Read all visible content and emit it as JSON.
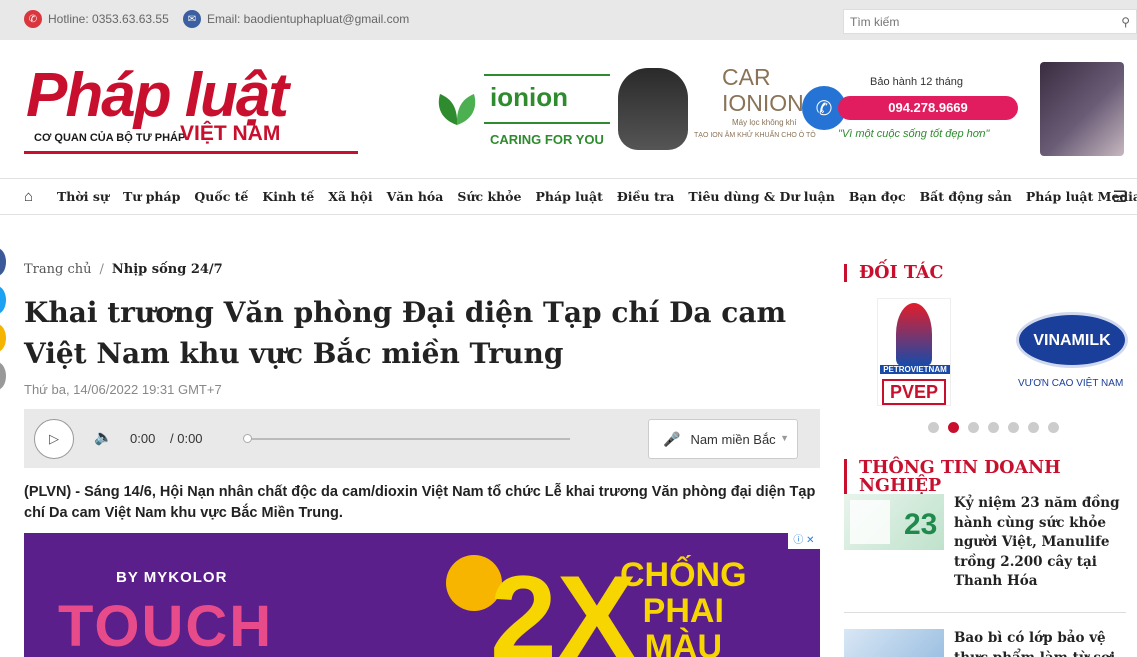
{
  "topbar": {
    "hotline": "Hotline: 0353.63.63.55",
    "email": "Email: baodientuphapluat@gmail.com",
    "search_placeholder": "Tìm kiếm"
  },
  "logo": {
    "word": "Pháp luật",
    "tagline": "CƠ QUAN CỦA BỘ TƯ PHÁP",
    "country": "VIỆT NAM"
  },
  "banner": {
    "brand": "ionion",
    "slogan": "CARING FOR YOU",
    "product_line1": "CAR",
    "product_line2": "IONION",
    "product_sub": "Máy lọc không khí",
    "product_sub2": "TẠO ION ÂM KHỬ KHUẨN CHO Ô TÔ",
    "warranty": "Bảo hành 12 tháng",
    "phone": "094.278.9669",
    "quote": "\"Vì một cuộc sống tốt đẹp hơn\""
  },
  "nav": {
    "items": [
      "Thời sự",
      "Tư pháp",
      "Quốc tế",
      "Kinh tế",
      "Xã hội",
      "Văn hóa",
      "Sức khỏe",
      "Pháp luật",
      "Điều tra",
      "Tiêu dùng & Dư luận",
      "Bạn đọc",
      "Bất động sản",
      "Pháp luật Media"
    ]
  },
  "breadcrumb": {
    "home": "Trang chủ",
    "separator": "/",
    "current": "Nhịp sống 24/7"
  },
  "article": {
    "title": "Khai trương Văn phòng Đại diện Tạp chí Da cam Việt Nam khu vực Bắc miền Trung",
    "date": "Thứ ba, 14/06/2022 19:31 GMT+7",
    "lead": "(PLVN) - Sáng 14/6, Hội Nạn nhân chất độc da cam/dioxin Việt Nam tổ chức Lễ khai trương Văn phòng đại diện Tạp chí Da cam Việt Nam khu vực Bắc Miền Trung."
  },
  "audio": {
    "current_time": "0:00",
    "duration": "/ 0:00",
    "voice": "Nam miền Bắc"
  },
  "ad": {
    "by": "BY MYKOLOR",
    "product": "TOUCH",
    "big": "2X",
    "line1": "CHỐNG",
    "line2": "PHAI",
    "line3": "MÀU"
  },
  "sidebar": {
    "partners_heading": "ĐỐI TÁC",
    "pvep_top": "PETROVIETNAM",
    "pvep_name": "PVEP",
    "vinamilk_name": "VINAMILK",
    "vinamilk_slogan": "VƯƠN CAO VIỆT NAM",
    "carousel_count": 7,
    "carousel_active": 2,
    "business_heading": "THÔNG TIN DOANH NGHIỆP",
    "news": [
      {
        "title": "Kỷ niệm 23 năm đồng hành cùng sức khỏe người Việt, Manulife trồng 2.200 cây tại Thanh Hóa"
      },
      {
        "title": "Bao bì có lớp bảo vệ thực phẩm làm từ sợi gỗ"
      }
    ]
  },
  "colors": {
    "brand_red": "#c8102e",
    "green": "#2e8b2e",
    "ad_purple": "#5a1f8a"
  }
}
